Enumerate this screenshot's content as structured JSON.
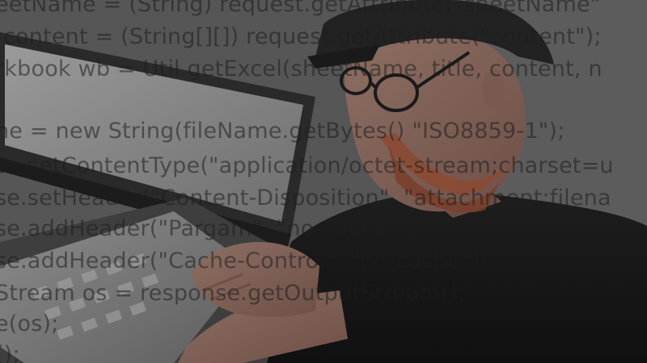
{
  "code_lines": [
    "eetName = (String) request.getAttribute(\"sheetName\"",
    "content = (String[][]) request.getAttribute(\"content\");",
    "rkbook wb = Util.getExcel(sheetName, title, content, n",
    "ne = new String(fileName.getBytes() \"ISO8859-1\");",
    "se.setContentType(\"application/octet-stream;charset=u",
    "se.setHeader(\"Content-Disposition\", \"attachment;filena",
    "se.addHeader(\"Pargam\", \"no-cache\");",
    "se.addHeader(\"Cache-Control\", \"no-cache\");",
    "Stream os = response.getOutputStream();",
    "e(os);",
    "();"
  ]
}
